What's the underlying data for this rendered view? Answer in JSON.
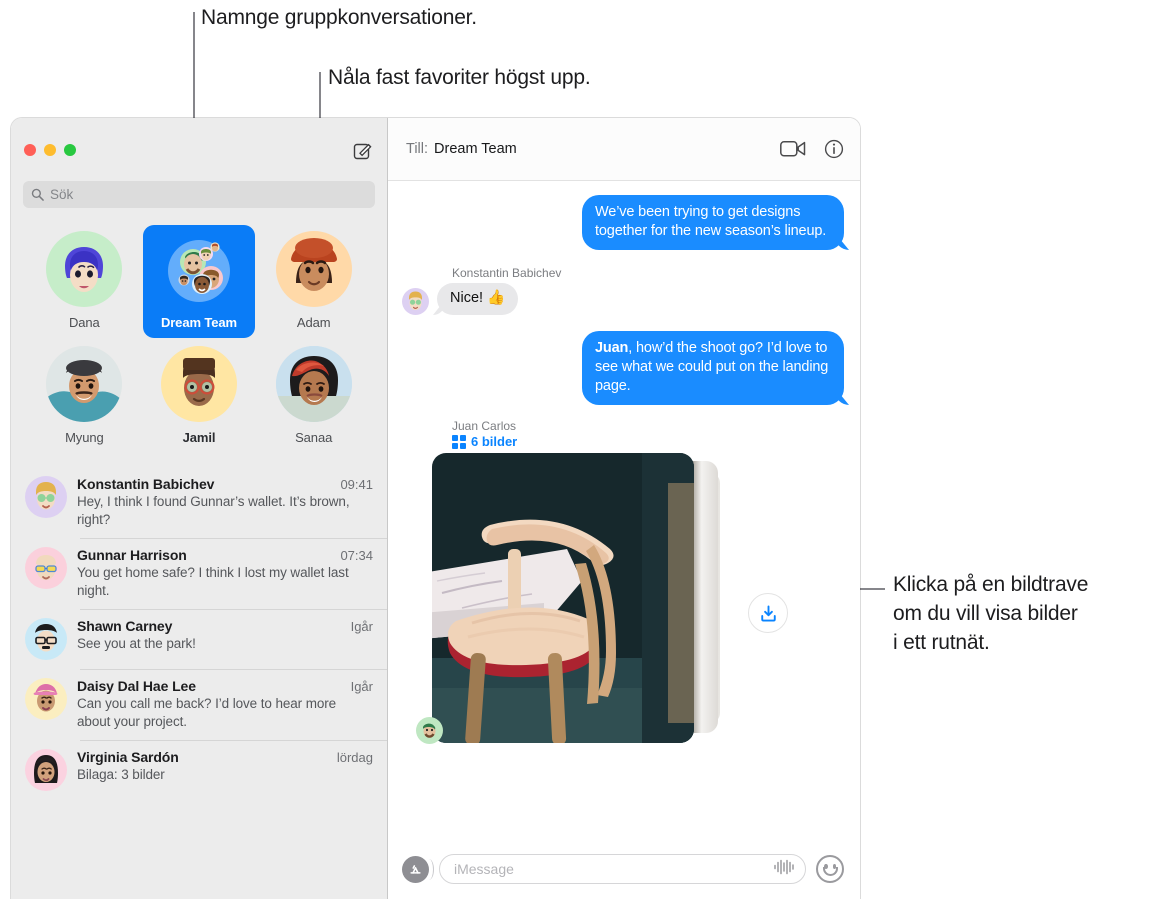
{
  "callouts": [
    {
      "id": "name-groups",
      "text": "Namnge gruppkonversationer."
    },
    {
      "id": "pin-favorites",
      "text": "Nåla fast favoriter högst upp."
    },
    {
      "id": "photo-stack",
      "line1": "Klicka på en bildtrave",
      "line2": "om du vill visa bilder",
      "line3": "i ett rutnät."
    }
  ],
  "window": {
    "traffic_lights": [
      "close",
      "minimize",
      "zoom"
    ],
    "compose_label": "compose-icon"
  },
  "sidebar": {
    "search": {
      "placeholder": "Sök",
      "icon": "search-icon"
    },
    "pinned": [
      {
        "name": "Dana",
        "selected": false,
        "bold": false
      },
      {
        "name": "Dream Team",
        "selected": true,
        "bold": true
      },
      {
        "name": "Adam",
        "selected": false,
        "bold": false
      },
      {
        "name": "Myung",
        "selected": false,
        "bold": false
      },
      {
        "name": "Jamil",
        "selected": false,
        "bold": true
      },
      {
        "name": "Sanaa",
        "selected": false,
        "bold": false
      }
    ],
    "conversations": [
      {
        "name": "Konstantin Babichev",
        "time": "09:41",
        "preview": "Hey, I think I found Gunnar’s wallet. It’s brown, right?"
      },
      {
        "name": "Gunnar Harrison",
        "time": "07:34",
        "preview": "You get home safe? I think I lost my wallet last night."
      },
      {
        "name": "Shawn Carney",
        "time": "Igår",
        "preview": "See you at the park!"
      },
      {
        "name": "Daisy Dal Hae Lee",
        "time": "Igår",
        "preview": "Can you call me back? I’d love to hear more about your project."
      },
      {
        "name": "Virginia Sardón",
        "time": "lördag",
        "preview": "Bilaga:  3 bilder"
      }
    ]
  },
  "chat": {
    "header": {
      "to_label": "Till:",
      "title": "Dream Team",
      "facetime_icon": "video-camera-icon",
      "info_icon": "info-circle-icon"
    },
    "messages": [
      {
        "type": "outgoing",
        "text": "We’ve been trying to get designs together for the new season’s lineup."
      },
      {
        "type": "incoming",
        "sender": "Konstantin Babichev",
        "text": "Nice!  👍"
      },
      {
        "type": "outgoing",
        "bold_prefix": "Juan",
        "text": ", how’d the shoot go? I’d love to see what we could put on the landing page."
      }
    ],
    "photo_stack": {
      "sender": "Juan Carlos",
      "count_label": "6 bilder",
      "grid_icon": "grid-icon",
      "download_icon": "download-icon"
    },
    "composer": {
      "apps_icon": "app-store-icon",
      "placeholder": "iMessage",
      "audio_icon": "audio-waveform-icon",
      "emoji_icon": "smiley-icon"
    }
  },
  "colors": {
    "accent_blue": "#0a7cf7",
    "bubble_out": "#1a8cff",
    "bubble_in": "#e8e8ea",
    "sidebar_bg": "#ececec",
    "link_blue": "#0a84ff"
  }
}
